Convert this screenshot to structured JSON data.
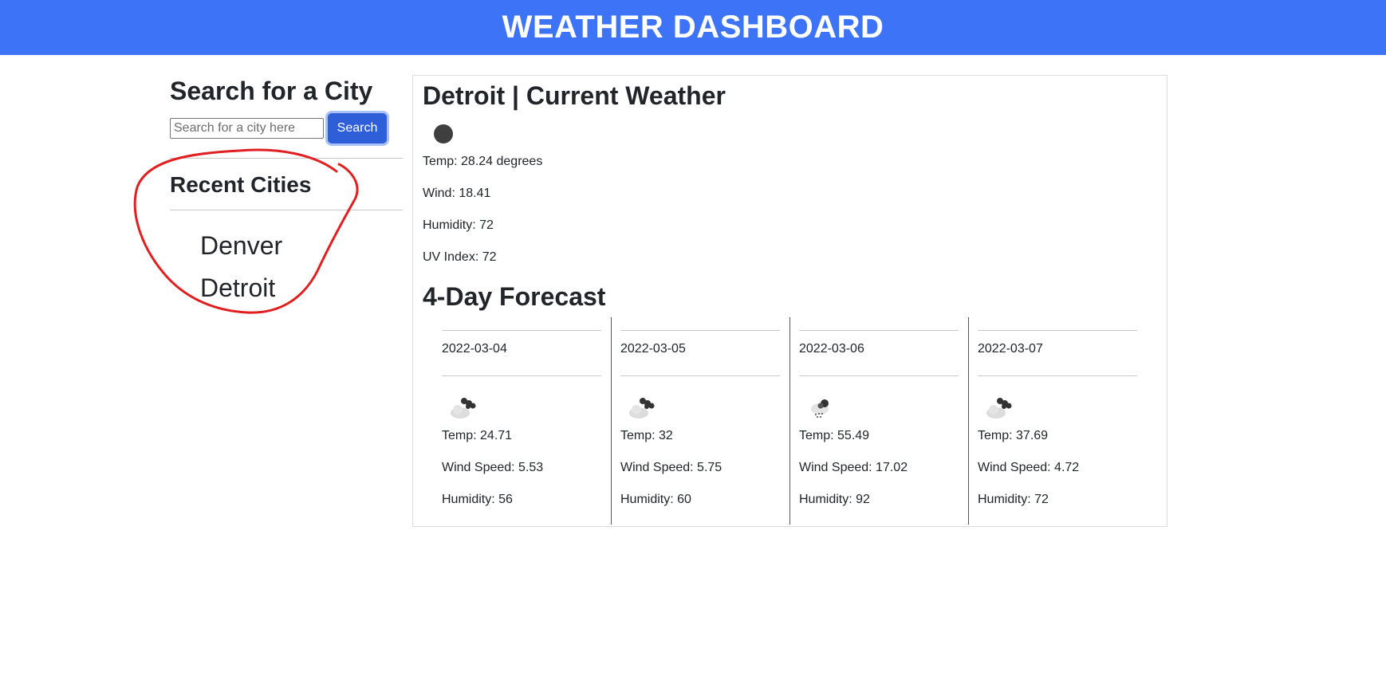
{
  "header": {
    "title": "WEATHER DASHBOARD"
  },
  "search": {
    "title": "Search for a City",
    "placeholder": "Search for a city here",
    "value": "",
    "button_label": "Search"
  },
  "recent": {
    "title": "Recent Cities",
    "cities": [
      "Denver",
      "Detroit"
    ]
  },
  "current": {
    "title": "Detroit | Current Weather",
    "icon": "dark-circle-icon",
    "temp": "Temp: 28.24 degrees",
    "wind": "Wind: 18.41",
    "humidity": "Humidity: 72",
    "uv": "UV Index: 72"
  },
  "forecast": {
    "title": "4-Day Forecast",
    "days": [
      {
        "date": "2022-03-04",
        "icon": "cloudy-icon",
        "temp": "Temp: 24.71",
        "wind": "Wind Speed: 5.53",
        "humidity": "Humidity: 56"
      },
      {
        "date": "2022-03-05",
        "icon": "cloudy-icon",
        "temp": "Temp: 32",
        "wind": "Wind Speed: 5.75",
        "humidity": "Humidity: 60"
      },
      {
        "date": "2022-03-06",
        "icon": "rain-cloud-icon",
        "temp": "Temp: 55.49",
        "wind": "Wind Speed: 17.02",
        "humidity": "Humidity: 92"
      },
      {
        "date": "2022-03-07",
        "icon": "cloudy-icon",
        "temp": "Temp: 37.69",
        "wind": "Wind Speed: 4.72",
        "humidity": "Humidity: 72"
      }
    ]
  },
  "colors": {
    "header_bg": "#3d74f7",
    "button_bg": "#2e5fd8",
    "annotation": "#e02020"
  }
}
